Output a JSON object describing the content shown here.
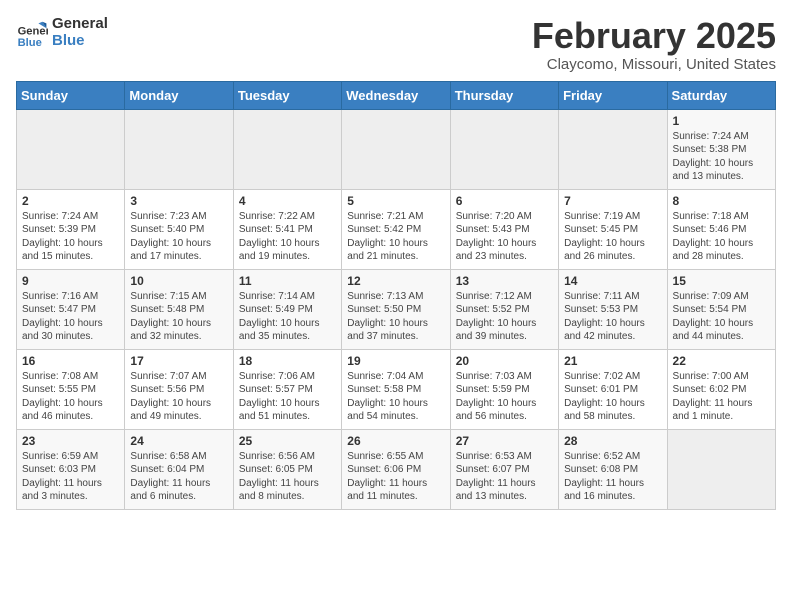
{
  "header": {
    "logo_line1": "General",
    "logo_line2": "Blue",
    "title": "February 2025",
    "subtitle": "Claycomo, Missouri, United States"
  },
  "weekdays": [
    "Sunday",
    "Monday",
    "Tuesday",
    "Wednesday",
    "Thursday",
    "Friday",
    "Saturday"
  ],
  "weeks": [
    [
      {
        "empty": true
      },
      {
        "empty": true
      },
      {
        "empty": true
      },
      {
        "empty": true
      },
      {
        "empty": true
      },
      {
        "empty": true
      },
      {
        "day": "1",
        "info": "Sunrise: 7:24 AM\nSunset: 5:38 PM\nDaylight: 10 hours and 13 minutes."
      }
    ],
    [
      {
        "day": "2",
        "info": "Sunrise: 7:24 AM\nSunset: 5:39 PM\nDaylight: 10 hours and 15 minutes."
      },
      {
        "day": "3",
        "info": "Sunrise: 7:23 AM\nSunset: 5:40 PM\nDaylight: 10 hours and 17 minutes."
      },
      {
        "day": "4",
        "info": "Sunrise: 7:22 AM\nSunset: 5:41 PM\nDaylight: 10 hours and 19 minutes."
      },
      {
        "day": "5",
        "info": "Sunrise: 7:21 AM\nSunset: 5:42 PM\nDaylight: 10 hours and 21 minutes."
      },
      {
        "day": "6",
        "info": "Sunrise: 7:20 AM\nSunset: 5:43 PM\nDaylight: 10 hours and 23 minutes."
      },
      {
        "day": "7",
        "info": "Sunrise: 7:19 AM\nSunset: 5:45 PM\nDaylight: 10 hours and 26 minutes."
      },
      {
        "day": "8",
        "info": "Sunrise: 7:18 AM\nSunset: 5:46 PM\nDaylight: 10 hours and 28 minutes."
      }
    ],
    [
      {
        "day": "9",
        "info": "Sunrise: 7:16 AM\nSunset: 5:47 PM\nDaylight: 10 hours and 30 minutes."
      },
      {
        "day": "10",
        "info": "Sunrise: 7:15 AM\nSunset: 5:48 PM\nDaylight: 10 hours and 32 minutes."
      },
      {
        "day": "11",
        "info": "Sunrise: 7:14 AM\nSunset: 5:49 PM\nDaylight: 10 hours and 35 minutes."
      },
      {
        "day": "12",
        "info": "Sunrise: 7:13 AM\nSunset: 5:50 PM\nDaylight: 10 hours and 37 minutes."
      },
      {
        "day": "13",
        "info": "Sunrise: 7:12 AM\nSunset: 5:52 PM\nDaylight: 10 hours and 39 minutes."
      },
      {
        "day": "14",
        "info": "Sunrise: 7:11 AM\nSunset: 5:53 PM\nDaylight: 10 hours and 42 minutes."
      },
      {
        "day": "15",
        "info": "Sunrise: 7:09 AM\nSunset: 5:54 PM\nDaylight: 10 hours and 44 minutes."
      }
    ],
    [
      {
        "day": "16",
        "info": "Sunrise: 7:08 AM\nSunset: 5:55 PM\nDaylight: 10 hours and 46 minutes."
      },
      {
        "day": "17",
        "info": "Sunrise: 7:07 AM\nSunset: 5:56 PM\nDaylight: 10 hours and 49 minutes."
      },
      {
        "day": "18",
        "info": "Sunrise: 7:06 AM\nSunset: 5:57 PM\nDaylight: 10 hours and 51 minutes."
      },
      {
        "day": "19",
        "info": "Sunrise: 7:04 AM\nSunset: 5:58 PM\nDaylight: 10 hours and 54 minutes."
      },
      {
        "day": "20",
        "info": "Sunrise: 7:03 AM\nSunset: 5:59 PM\nDaylight: 10 hours and 56 minutes."
      },
      {
        "day": "21",
        "info": "Sunrise: 7:02 AM\nSunset: 6:01 PM\nDaylight: 10 hours and 58 minutes."
      },
      {
        "day": "22",
        "info": "Sunrise: 7:00 AM\nSunset: 6:02 PM\nDaylight: 11 hours and 1 minute."
      }
    ],
    [
      {
        "day": "23",
        "info": "Sunrise: 6:59 AM\nSunset: 6:03 PM\nDaylight: 11 hours and 3 minutes."
      },
      {
        "day": "24",
        "info": "Sunrise: 6:58 AM\nSunset: 6:04 PM\nDaylight: 11 hours and 6 minutes."
      },
      {
        "day": "25",
        "info": "Sunrise: 6:56 AM\nSunset: 6:05 PM\nDaylight: 11 hours and 8 minutes."
      },
      {
        "day": "26",
        "info": "Sunrise: 6:55 AM\nSunset: 6:06 PM\nDaylight: 11 hours and 11 minutes."
      },
      {
        "day": "27",
        "info": "Sunrise: 6:53 AM\nSunset: 6:07 PM\nDaylight: 11 hours and 13 minutes."
      },
      {
        "day": "28",
        "info": "Sunrise: 6:52 AM\nSunset: 6:08 PM\nDaylight: 11 hours and 16 minutes."
      },
      {
        "empty": true
      }
    ]
  ]
}
